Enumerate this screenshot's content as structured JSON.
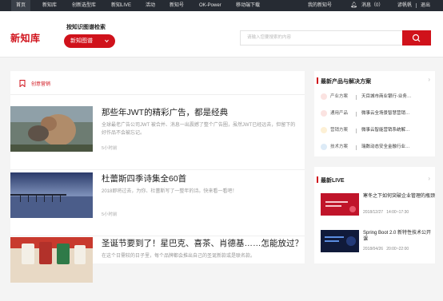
{
  "topbar": {
    "nav": [
      "首页",
      "新知库",
      "创新选型库",
      "新知LIVE",
      "活动",
      "新知号",
      "OK-Power",
      "移动端下载"
    ],
    "right": {
      "my_account": "我的新知号",
      "messages": "消息（0）",
      "username": "谚帆帆",
      "logout": "退出"
    }
  },
  "header": {
    "logo": "新知库",
    "kg_title": "按知识图谱检索",
    "kg_button": "新知图谱",
    "search_placeholder": "请输入您要搜索的内容"
  },
  "main": {
    "section_label": "创意营销",
    "articles": [
      {
        "title": "那些年JWT的精彩广告，都是经典",
        "desc": "全球最老广告公司JWT 被合并、消息一出震撼了整个广告圈，虽然JWT已经远去，但留下的好作品不会被忘记。",
        "time": "5小时前"
      },
      {
        "title": "杜蕾斯四季诗集全60首",
        "desc": "2018即将过去，为你、杜蕾斯写了一整年的诗。快来看一看吧！",
        "time": "5小时前"
      },
      {
        "title": "圣诞节要到了！星巴克、喜茶、肖德基……怎能放过？",
        "desc": "在这个日需较的日子里，每个品牌都会推出自己的圣诞新款或是联名款。",
        "time": ""
      }
    ]
  },
  "sidebar": {
    "products": {
      "title": "最新产品与解决方案",
      "items": [
        {
          "category": "产业方案",
          "name": "天目城市商业银行-业务…",
          "color": "#e74c3c"
        },
        {
          "category": "通用产品",
          "name": "微事云全场景智慧营销…",
          "color": "#e74c3c"
        },
        {
          "category": "营销方案",
          "name": "微事云智能营销系统解…",
          "color": "#f39c12"
        },
        {
          "category": "技术方案",
          "name": "瑞数动态安全金融行业…",
          "color": "#3498db"
        }
      ]
    },
    "live": {
      "title": "最新LIVE",
      "items": [
        {
          "title": "寒冬之下如何突破企业管理的瓶颈",
          "date": "2018/12/27",
          "time": "14:00~17:30"
        },
        {
          "title": "Spring Boot 2.0 新特性技术公开课",
          "date": "2018/04/26",
          "time": "20:00~22:00"
        }
      ]
    }
  },
  "colors": {
    "brand": "#d0121b",
    "topbar": "#262b33"
  }
}
